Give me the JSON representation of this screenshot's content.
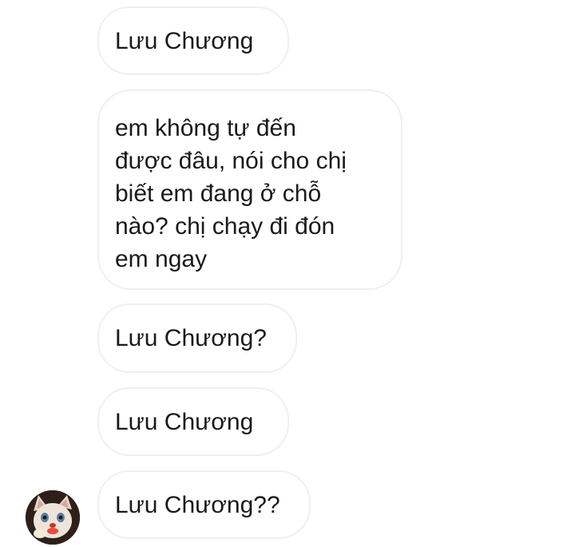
{
  "conversation": {
    "messages": [
      {
        "lines": [
          "Lưu Chương"
        ]
      },
      {
        "lines": [
          "em không tự đến",
          "được đâu, nói cho chị",
          "biết em đang ở chỗ",
          "nào? chị chạy đi đón",
          "em ngay"
        ]
      },
      {
        "lines": [
          "Lưu Chương?"
        ]
      },
      {
        "lines": [
          "Lưu Chương"
        ]
      },
      {
        "lines": [
          "Lưu Chương??"
        ]
      }
    ],
    "avatar_icon": "cat-avatar-icon"
  }
}
